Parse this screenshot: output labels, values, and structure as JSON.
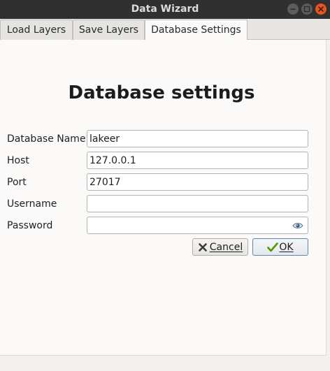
{
  "window": {
    "title": "Data Wizard"
  },
  "tabs": [
    {
      "label": "Load Layers",
      "active": false
    },
    {
      "label": "Save Layers",
      "active": false
    },
    {
      "label": "Database Settings",
      "active": true
    }
  ],
  "main": {
    "heading": "Database settings",
    "fields": {
      "database_name": {
        "label": "Database Name",
        "value": "lakeer"
      },
      "host": {
        "label": "Host",
        "value": "127.0.0.1"
      },
      "port": {
        "label": "Port",
        "value": "27017"
      },
      "username": {
        "label": "Username",
        "value": ""
      },
      "password": {
        "label": "Password",
        "value": ""
      }
    },
    "buttons": {
      "cancel": {
        "label": "Cancel",
        "icon": "cancel-x-icon"
      },
      "ok": {
        "label": "OK",
        "icon": "checkmark-icon"
      }
    }
  },
  "icons": {
    "password_toggle": "eye-icon",
    "window_minimize": "minimize-icon",
    "window_maximize": "maximize-icon",
    "window_close": "close-icon"
  },
  "colors": {
    "titlebar": "#303030",
    "close_button": "#e95420",
    "ok_icon": "#4e9a06",
    "panel_background": "#fbfaf9"
  }
}
